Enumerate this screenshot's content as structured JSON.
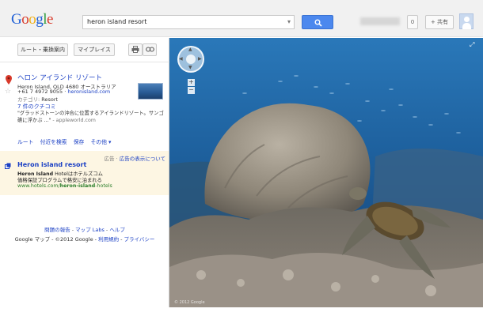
{
  "header": {
    "logo_text": "Google",
    "search": {
      "value": "heron island resort",
      "dropdown_glyph": "▾"
    },
    "search_button_icon": "search-icon",
    "notifications_count": "0",
    "share_label": "+ 共有",
    "avatar_icon": "user-avatar-icon"
  },
  "toolbar": {
    "route_label": "ルート・乗換案内",
    "mymaps_label": "マイプレイス",
    "print_icon": "print-icon",
    "link_icon": "link-icon"
  },
  "place": {
    "title": "ヘロン アイランド リゾート",
    "address": "Heron Island, QLD 4680 オーストラリア",
    "phone": "+61 7 4972 9055",
    "phone_sep": " · ",
    "website": "heronisland.com",
    "category_label": "カテゴリ:",
    "category_value": "Resort",
    "reviews": "7 件のクチコミ",
    "snippet": "\"グラッドストーンの沖合に位置するアイランドリゾート。サンゴ礁に浮かぶ ...\"",
    "snippet_source": " - appleworld.com",
    "actions": [
      "ルート",
      "付近を検索",
      "保存",
      "その他 ▾"
    ]
  },
  "ad": {
    "label": "広告 · ",
    "about_link": "広告の表示について",
    "title": "Heron island resort",
    "desc1_bold": "Heron Island",
    "desc1_rest": " Hotelはホテルズコム",
    "desc2": "価格保証プログラムで格安に泊まれる",
    "url_prefix": "www.hotels.com/",
    "url_bold": "heron-island",
    "url_suffix": "-hotels"
  },
  "footer": {
    "report": "問題の報告",
    "sep1": " - ",
    "labs": "マップ Labs",
    "sep2": " - ",
    "help": "ヘルプ",
    "copyright": "Google マップ - ©2012 Google - ",
    "terms": "利用規約",
    "sep3": " - ",
    "privacy": "プライバシー"
  },
  "streetview": {
    "zoom_in": "+",
    "zoom_out": "−",
    "expand_glyph": "⤢",
    "copyright": "© 2012 Google"
  },
  "colors": {
    "link": "#1a3fc4",
    "search_button": "#4c88ee",
    "ad_background": "#fdf6e3",
    "ad_url": "#2a7d2a"
  }
}
